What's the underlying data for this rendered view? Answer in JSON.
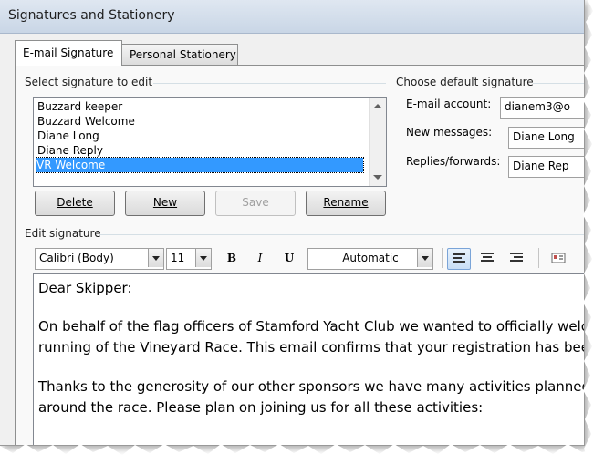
{
  "window": {
    "title": "Signatures and Stationery"
  },
  "tabs": [
    {
      "label": "E-mail Signature",
      "active": true
    },
    {
      "label": "Personal Stationery",
      "active": false
    }
  ],
  "select_section": {
    "label": "Select signature to edit",
    "items": [
      "Buzzard keeper",
      "Buzzard Welcome",
      "Diane Long",
      "Diane Reply",
      "VR Welcome"
    ],
    "selected": "VR Welcome"
  },
  "buttons": {
    "delete": "Delete",
    "new": "New",
    "save": "Save",
    "rename": "Rename"
  },
  "default_section": {
    "label": "Choose default signature",
    "email_account_label": "E-mail account:",
    "email_account_value": "dianem3@o",
    "new_messages_label": "New messages:",
    "new_messages_value": "Diane Long",
    "replies_label": "Replies/forwards:",
    "replies_value": "Diane Rep"
  },
  "edit_section": {
    "label": "Edit signature",
    "font": "Calibri (Body)",
    "size": "11",
    "bold": "B",
    "italic": "I",
    "underline": "U",
    "color": "Automatic"
  },
  "editor": {
    "lines": [
      "Dear Skipper:",
      "",
      "On behalf of the flag officers of Stamford Yacht Club we wanted to officially welc",
      "running of the Vineyard Race. This email confirms that your registration has been",
      "",
      "Thanks to the generosity of our other sponsors we have many activities planned",
      "around the race. Please plan on joining us for all these activities:"
    ]
  },
  "icons": [
    "chevron-up-icon",
    "chevron-down-icon",
    "align-left-icon",
    "align-center-icon",
    "align-right-icon",
    "business-card-icon"
  ]
}
